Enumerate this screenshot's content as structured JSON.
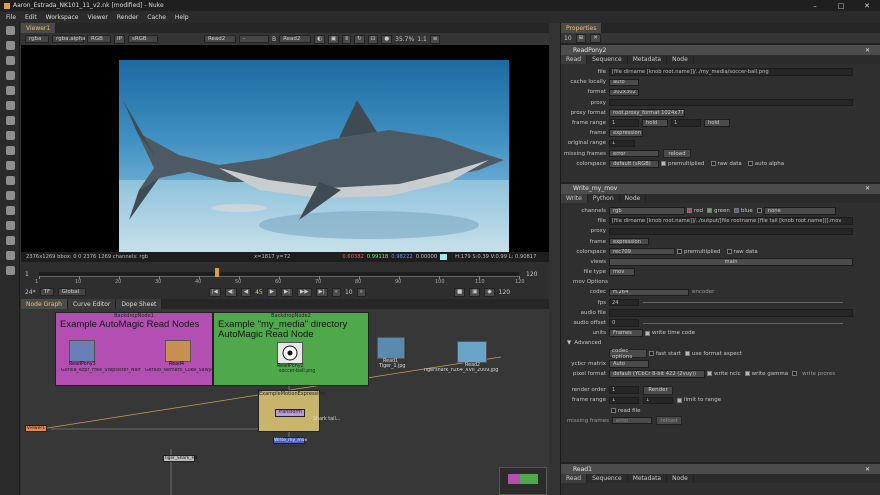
{
  "window": {
    "title": "Aaron_Estrada_NK101_11_v2.nk [modified] - Nuke"
  },
  "menu": [
    "File",
    "Edit",
    "Workspace",
    "Viewer",
    "Render",
    "Cache",
    "Help"
  ],
  "viewer": {
    "tab": "Viewer1",
    "channels": "rgba",
    "channel_alpha": "rgba.alpha",
    "display": "RGB",
    "ip": "IP",
    "colorspace": "sRGB",
    "input_a": "Read2",
    "input_dash": "-",
    "input_b": "B",
    "input_b_name": "Read2",
    "zoom": "35.7%",
    "ratio": "1:1",
    "view2d": "2D",
    "info_left": "2376x1269  bbox: 0 0 2376 1269 channels: rgb",
    "info_xy": "x=1817 y=72",
    "info_r": "0.60382",
    "info_g": "0.99118",
    "info_b": "0.98222",
    "info_a": "0.00000",
    "info_hsv": "H:179 S:0.39 V:0.99  L: 0.90817"
  },
  "timeline": {
    "ticks": [
      "1",
      "10",
      "20",
      "30",
      "40",
      "50",
      "60",
      "70",
      "80",
      "90",
      "100",
      "110",
      "120"
    ],
    "frame_start": "1",
    "frame_end": "120",
    "frame_end2": "120",
    "current": "45",
    "fps": "24*",
    "tf": "TF",
    "global": "Global",
    "step": "10",
    "playhead": 0.37
  },
  "nodegraph": {
    "tabs": [
      "Node Graph",
      "Curve Editor",
      "Dope Sheet"
    ],
    "bd1_label": "BackdropNode1",
    "bd1_title": "Example AutoMagic Read Nodes",
    "bd2_label": "BackdropNode2",
    "bd2_title_1": "Example \"my_media\" directory",
    "bd2_title_2": "AutoMagic Read Node",
    "readpony3": "ReadPony3",
    "readpony3_sub": "Gorilla_ezpr_Free_Stepsister_Named_Goliath_Vol2",
    "read4": "Read4",
    "read4_sub": "Gerald_Nemetti_Luke_Sawyer_2004.JPG",
    "readpony2": "ReadPony2",
    "readpony2_sub": "soccer-ball.png",
    "read1": "Read1",
    "read1_sub": "Tiger_1.jpg",
    "read2": "Read2",
    "read2_sub": "Tigershark_h264_XVII_2009.jpg",
    "expr_label": "ExampleMotionExpression",
    "transform": "Transform",
    "write": "Write_my_mov",
    "viewer_node": "Viewer1",
    "note": "Shark tail...",
    "stickynode": "Tiger_Shark_Hit"
  },
  "properties": {
    "tab": "Properties",
    "count": "10",
    "readpony2": {
      "name": "ReadPony2",
      "tabs": [
        "Read",
        "Sequence",
        "Metadata",
        "Node"
      ],
      "file": "[file dirname [knob root.name]]/../my_media/soccer-ball.png",
      "cache_locally": "auto",
      "format": "302x302",
      "proxy": "",
      "proxy_format": "root.proxy_format 1024x778",
      "frame_range_start": "1",
      "frame_range_mode": "hold",
      "frame_range_end": "1",
      "frame_range_mode2": "hold",
      "frame": "expression",
      "original_range": "1",
      "missing_frames": "error",
      "reload": "reload",
      "colorspace": "default (sRGB)",
      "premultiplied": "premultiplied",
      "raw_data": "raw data",
      "auto_alpha": "auto alpha"
    },
    "write": {
      "name": "Write_my_mov",
      "tabs": [
        "Write",
        "Python",
        "Node"
      ],
      "channels": "rgb",
      "red": "red",
      "green": "green",
      "blue": "blue",
      "none": "none",
      "file": "[file dirname [knob root.name]]/../output/[file rootname [file tail [knob root.name]]].mov",
      "proxy": "",
      "frame": "expression",
      "colorspace": "rec709",
      "premultiplied": "premultiplied",
      "raw_data": "raw data",
      "views": "main",
      "file_type": "mov",
      "mov_options": "mov Options",
      "codec": "H.264",
      "encoder": "encoder",
      "fps": "24",
      "audio_file": "",
      "audio_offset": "0",
      "units": "Frames",
      "write_timecode": "write time code",
      "advanced": "Advanced",
      "codec_options": "codec options",
      "fast_start": "fast start",
      "use_format_aspect": "use format aspect",
      "ycbcr_matrix": "Auto",
      "pixel_format": "default (YCbCr  8-bit 422 (2vuy))",
      "write_nclc": "write nclc",
      "write_gamma": "write gamma",
      "write_prores": "write prores",
      "render_order": "1",
      "render": "Render",
      "frame_range_start": "1",
      "frame_range_end": "1",
      "limit_to_range": "limit to range",
      "read_file": "read file",
      "missing_frames": "error",
      "reload": "reload"
    },
    "read1": {
      "name": "Read1",
      "tabs": [
        "Read",
        "Sequence",
        "Metadata",
        "Node"
      ]
    }
  },
  "labels": {
    "file": "file",
    "cache_locally": "cache locally",
    "format": "format",
    "proxy": "proxy",
    "proxy_format": "proxy format",
    "frame_range": "frame range",
    "frame": "frame",
    "original_range": "original range",
    "missing_frames": "missing frames",
    "colorspace": "colorspace",
    "channels": "channels",
    "views": "views",
    "file_type": "file type",
    "codec": "codec",
    "fps": "fps",
    "audio_file": "audio file",
    "audio_offset": "audio offset",
    "units": "units",
    "ycbcr_matrix": "ycbcr matrix",
    "pixel_format": "pixel format",
    "render_order": "render order"
  },
  "colors": {
    "accent": "#d8a23a",
    "backdrop1": "#b34fb3",
    "backdrop2": "#4fa84a",
    "expr_backdrop": "#c8b46a",
    "write_node": "#4a62c8",
    "viewer_node": "#e8894a"
  }
}
